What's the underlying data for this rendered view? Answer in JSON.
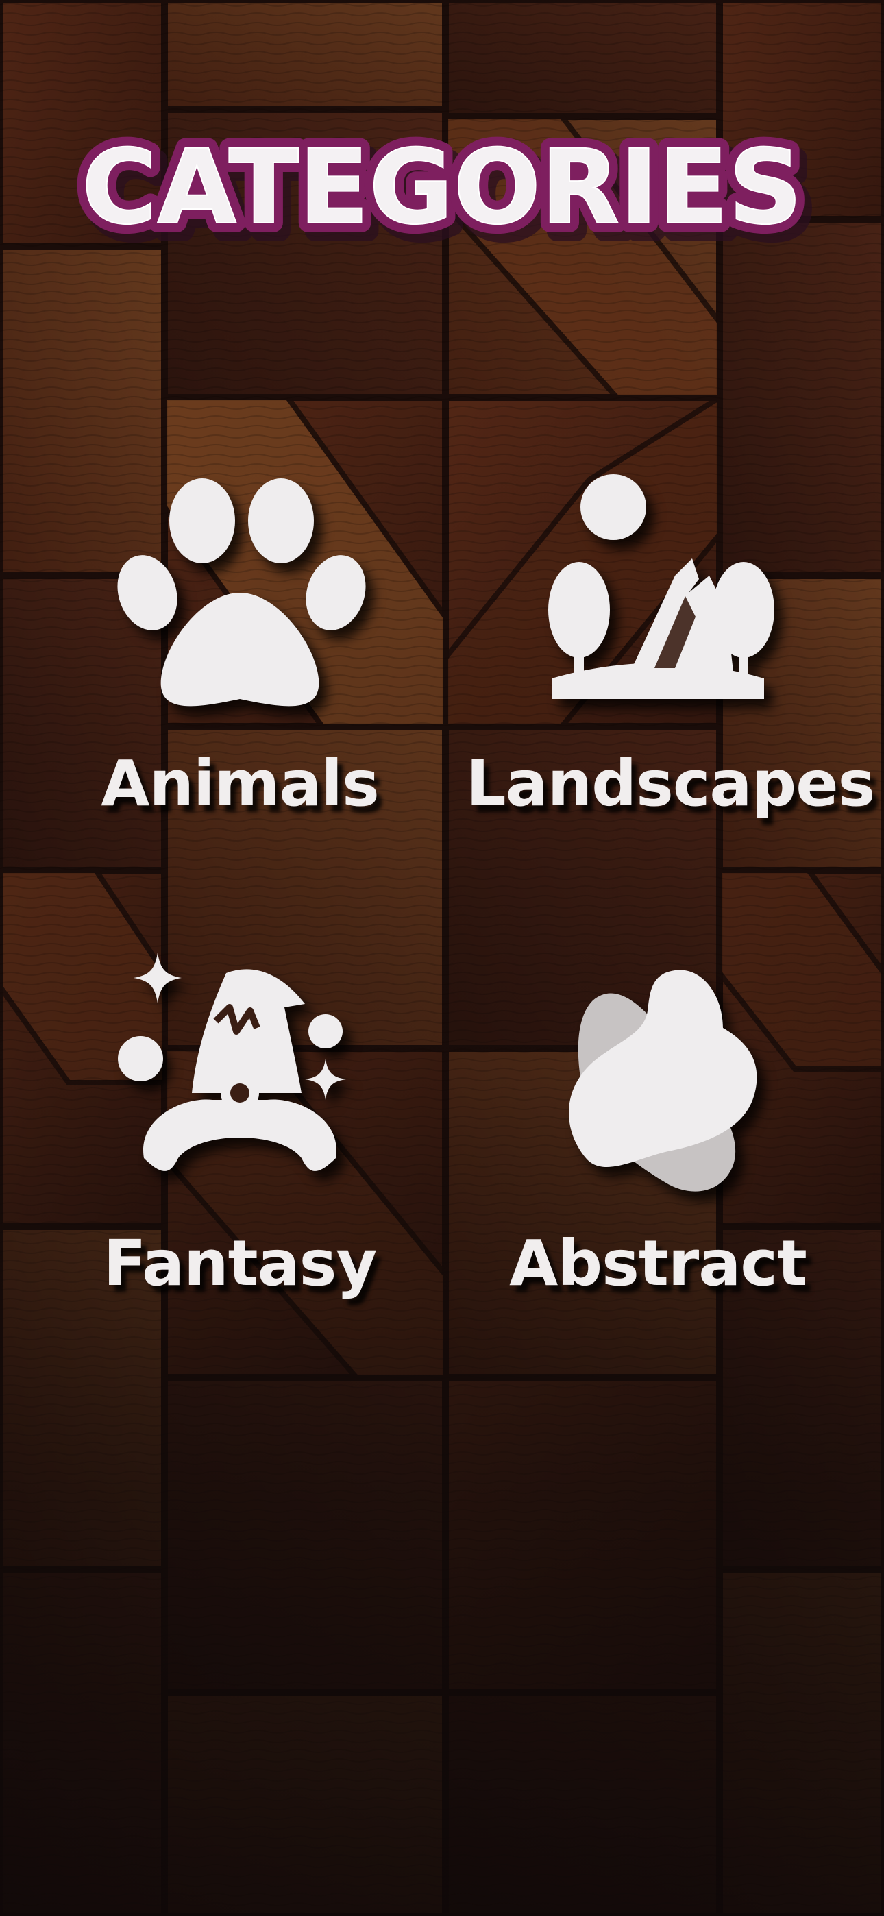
{
  "screen": {
    "title": "CATEGORIES"
  },
  "categories": [
    {
      "label": "Animals",
      "icon": "paw-icon"
    },
    {
      "label": "Landscapes",
      "icon": "landscape-icon"
    },
    {
      "label": "Fantasy",
      "icon": "wizard-gnome-icon"
    },
    {
      "label": "Abstract",
      "icon": "abstract-blob-icon"
    }
  ],
  "colors": {
    "title_fill": "#f4f1f3",
    "title_outline": "#7e1f5f",
    "icon_fill": "#efedee",
    "icon_secondary": "#c7c3c3",
    "label_text": "#f1eeee",
    "background_wood": "#5a2e1c"
  }
}
